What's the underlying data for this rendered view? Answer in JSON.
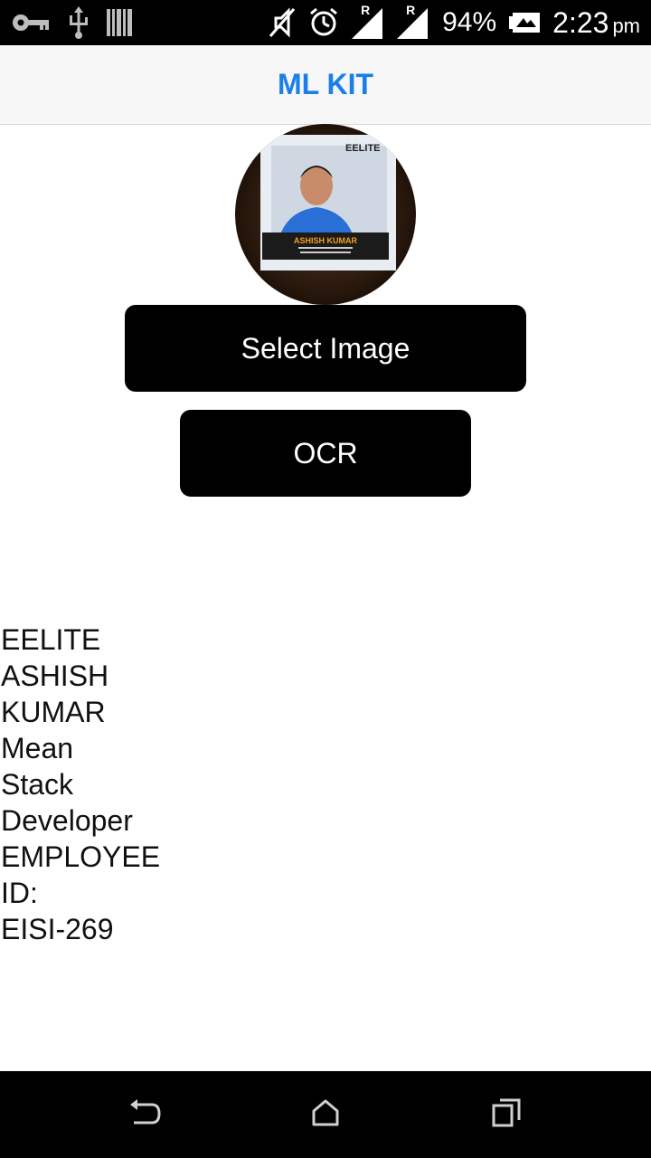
{
  "status_bar": {
    "battery_percent": "94%",
    "time": "2:23",
    "ampm": "pm",
    "signal_labels": [
      "R",
      "R"
    ],
    "icons": [
      "key-icon",
      "usb-icon",
      "barcode-icon",
      "mute-icon",
      "alarm-icon",
      "signal-icon",
      "signal-icon",
      "battery-icon"
    ]
  },
  "app_bar": {
    "title": "ML KIT",
    "title_color": "#1a7fe8"
  },
  "profile_image": {
    "badge_brand": "EELITE",
    "badge_name": "ASHISH KUMAR"
  },
  "buttons": {
    "select_image": "Select Image",
    "ocr": "OCR"
  },
  "ocr_result": {
    "lines": [
      "EELITE",
      "ASHISH",
      "KUMAR",
      "Mean",
      "Stack",
      "Developer",
      "EMPLOYEE",
      "ID:",
      "EISI-269"
    ]
  },
  "nav_bar": {
    "icons": [
      "back-icon",
      "home-icon",
      "recent-apps-icon"
    ]
  }
}
